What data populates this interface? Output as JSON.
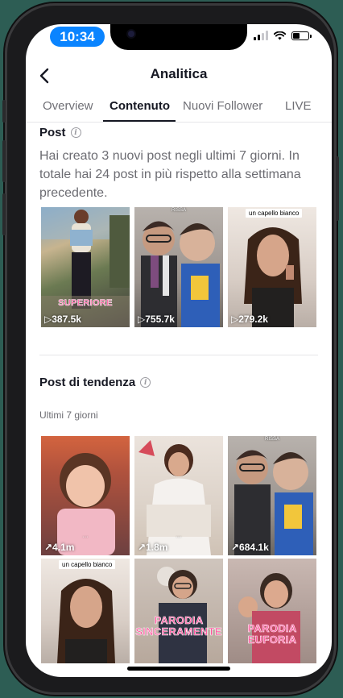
{
  "status_bar": {
    "time": "10:34"
  },
  "header": {
    "title": "Analitica"
  },
  "tabs": [
    {
      "label": "Overview",
      "active": false
    },
    {
      "label": "Contenuto",
      "active": true
    },
    {
      "label": "Nuovi Follower",
      "active": false
    },
    {
      "label": "LIVE",
      "active": false
    }
  ],
  "posts": {
    "title": "Post",
    "description": "Hai creato 3 nuovi post negli ultimi 7 giorni. In totale hai 24 post in più rispetto alla settimana precedente.",
    "items": [
      {
        "views": "▷387.5k",
        "overlay": "SUPERIORE"
      },
      {
        "views": "▷755.7k",
        "overlay": "RISSA"
      },
      {
        "views": "▷279.2k",
        "overlay": "un capello bianco"
      }
    ]
  },
  "trending": {
    "title": "Post di tendenza",
    "subtitle": "Ultimi 7 giorni",
    "items": [
      {
        "views": "↗4.1m",
        "overlay": ""
      },
      {
        "views": "↗1.8m",
        "overlay": ""
      },
      {
        "views": "↗684.1k",
        "overlay": "RISSA"
      },
      {
        "views": "",
        "overlay": "un capello bianco"
      },
      {
        "views": "",
        "overlay": "PARODIA SINCERAMENTE"
      },
      {
        "views": "",
        "overlay": "PARODIA EUFORIA"
      }
    ]
  },
  "colors": {
    "time_pill": "#0a84ff",
    "text_primary": "#161823",
    "text_secondary": "#6c6c72",
    "caption_pink": "#ff4f9a"
  }
}
